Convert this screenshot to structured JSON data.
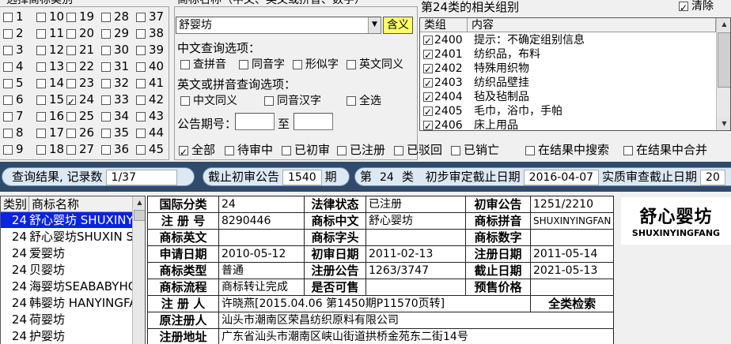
{
  "class_group": {
    "title": "选择商标类别",
    "items": [
      {
        "n": "1",
        "on": false
      },
      {
        "n": "2",
        "on": false
      },
      {
        "n": "3",
        "on": false
      },
      {
        "n": "4",
        "on": false
      },
      {
        "n": "5",
        "on": false
      },
      {
        "n": "6",
        "on": false
      },
      {
        "n": "7",
        "on": false
      },
      {
        "n": "8",
        "on": false
      },
      {
        "n": "9",
        "on": false
      },
      {
        "n": "10",
        "on": false
      },
      {
        "n": "11",
        "on": false
      },
      {
        "n": "12",
        "on": false
      },
      {
        "n": "13",
        "on": false
      },
      {
        "n": "14",
        "on": false
      },
      {
        "n": "15",
        "on": false
      },
      {
        "n": "16",
        "on": false
      },
      {
        "n": "17",
        "on": false
      },
      {
        "n": "18",
        "on": false
      },
      {
        "n": "19",
        "on": false
      },
      {
        "n": "20",
        "on": false
      },
      {
        "n": "21",
        "on": false
      },
      {
        "n": "22",
        "on": false
      },
      {
        "n": "23",
        "on": false
      },
      {
        "n": "24",
        "on": true
      },
      {
        "n": "25",
        "on": false
      },
      {
        "n": "26",
        "on": false
      },
      {
        "n": "27",
        "on": false
      },
      {
        "n": "28",
        "on": false
      },
      {
        "n": "29",
        "on": false
      },
      {
        "n": "30",
        "on": false
      },
      {
        "n": "31",
        "on": false
      },
      {
        "n": "32",
        "on": false
      },
      {
        "n": "33",
        "on": false
      },
      {
        "n": "34",
        "on": false
      },
      {
        "n": "35",
        "on": false
      },
      {
        "n": "36",
        "on": false
      },
      {
        "n": "37",
        "on": false
      },
      {
        "n": "38",
        "on": false
      },
      {
        "n": "39",
        "on": false
      },
      {
        "n": "40",
        "on": false
      },
      {
        "n": "41",
        "on": false
      },
      {
        "n": "42",
        "on": false
      },
      {
        "n": "43",
        "on": false
      },
      {
        "n": "44",
        "on": false
      },
      {
        "n": "45",
        "on": false
      }
    ]
  },
  "name_group": {
    "title": "商标名称（中文、英文或拼音、数字）",
    "name_value": "舒婴坊",
    "match_button": "含义",
    "cn_options_label": "中文查询选项：",
    "cn_options": [
      "查拼音",
      "同音字",
      "形似字",
      "英文同义"
    ],
    "en_options_label": "英文或拼音查询选项：",
    "en_options": [
      "中文同义",
      "同音汉字",
      "全选"
    ],
    "period_label": "公告期号：",
    "period_to": "至"
  },
  "related_group": {
    "title": "第24类的相关组别",
    "clear_label": "清除",
    "clear_checked": true,
    "col_group": "类组",
    "col_content": "内容",
    "rows": [
      {
        "code": "2400",
        "text": "提示：不确定组别信息"
      },
      {
        "code": "2401",
        "text": "纺织品，布料"
      },
      {
        "code": "2402",
        "text": "特殊用织物"
      },
      {
        "code": "2403",
        "text": "纺织品壁挂"
      },
      {
        "code": "2404",
        "text": "毡及毡制品"
      },
      {
        "code": "2405",
        "text": "毛巾，浴巾，手帕"
      },
      {
        "code": "2406",
        "text": "床上用品"
      }
    ]
  },
  "status_filters": [
    {
      "label": "全部",
      "on": true
    },
    {
      "label": "待审中",
      "on": false
    },
    {
      "label": "已初审",
      "on": false
    },
    {
      "label": "已注册",
      "on": false
    },
    {
      "label": "已驳回",
      "on": false
    },
    {
      "label": "已销亡",
      "on": false
    }
  ],
  "search_filters": [
    "在结果中搜索",
    "在结果中合并"
  ],
  "info_bar": {
    "result_label": "查询结果, 记录数",
    "result_value": "1/37",
    "cutoff_label": "截止初审公告",
    "cutoff_value": "1540",
    "cutoff_unit": "期",
    "class_prefix": "第",
    "class_value": "24",
    "class_suffix": "类",
    "prelim_label": "初步审定截止日期",
    "prelim_value": "2016-04-07",
    "exam_label": "实质审查截止日期",
    "exam_value": "20"
  },
  "results": {
    "col_class": "类别",
    "col_name": "商标名称",
    "rows": [
      {
        "c": "24",
        "name": "舒心婴坊 SHUXINY",
        "sel": true
      },
      {
        "c": "24",
        "name": "舒心婴坊SHUXIN S",
        "sel": false
      },
      {
        "c": "24",
        "name": "爱婴坊",
        "sel": false
      },
      {
        "c": "24",
        "name": "贝婴坊",
        "sel": false
      },
      {
        "c": "24",
        "name": "海婴坊SEABABYHOU",
        "sel": false
      },
      {
        "c": "24",
        "name": "韩婴坊 HANYINGFA",
        "sel": false
      },
      {
        "c": "24",
        "name": "荷婴坊",
        "sel": false
      },
      {
        "c": "24",
        "name": "护婴坊",
        "sel": false
      }
    ]
  },
  "detail": {
    "k_intl_class": "国际分类",
    "v_intl_class": "24",
    "k_legal": "法律状态",
    "v_legal": "已注册",
    "k_prelim": "初审公告",
    "v_prelim": "1251/2210",
    "k_regno": "注 册 号",
    "v_regno": "8290446",
    "k_cn": "商标中文",
    "v_cn": "舒心婴坊",
    "k_py": "商标拼音",
    "v_py": "SHUXINYINGFAN",
    "k_en": "商标英文",
    "v_en": "",
    "k_initial": "商标字头",
    "v_initial": "",
    "k_num": "商标数字",
    "v_num": "",
    "k_apply": "申请日期",
    "v_apply": "2010-05-12",
    "k_pdate": "初审日期",
    "v_pdate": "2011-02-13",
    "k_rdate": "注册日期",
    "v_rdate": "2011-05-14",
    "k_type": "商标类型",
    "v_type": "普通",
    "k_rnotice": "注册公告",
    "v_rnotice": "1263/3747",
    "k_end": "截止日期",
    "v_end": "2021-05-13",
    "k_flow": "商标流程",
    "v_flow": "商标转让完成",
    "k_sell": "是否可售",
    "v_sell": "",
    "k_price": "预售价格",
    "v_price": "",
    "k_reg": "注 册 人",
    "v_reg": "许晓燕[2015.04.06 第1450期P11570页转]",
    "full_search": "全类检索",
    "k_orig": "原注册人",
    "v_orig": "汕头市潮南区荣昌纺织原料有限公司",
    "k_addr": "注册地址",
    "v_addr": "广东省汕头市潮南区峡山街道拱桥金苑东二街14号"
  },
  "logo": {
    "cn": "舒心婴坊",
    "en": "SHUXINYINGFANG"
  }
}
